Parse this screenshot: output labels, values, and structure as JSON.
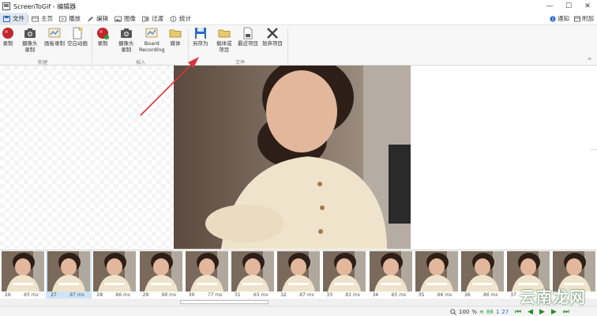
{
  "window": {
    "title": "ScreenToGif - 编辑器",
    "minimize_glyph": "—",
    "maximize_glyph": "☐",
    "close_glyph": "✕"
  },
  "menubar": {
    "tabs": [
      {
        "label": "文件",
        "icon": "save-icon",
        "active": true
      },
      {
        "label": "主页",
        "icon": "home-icon",
        "active": false
      },
      {
        "label": "播放",
        "icon": "play-icon",
        "active": false
      },
      {
        "label": "编辑",
        "icon": "pencil-icon",
        "active": false
      },
      {
        "label": "图像",
        "icon": "image-icon",
        "active": false
      },
      {
        "label": "过渡",
        "icon": "transition-icon",
        "active": false
      },
      {
        "label": "统计",
        "icon": "info-icon",
        "active": false
      }
    ],
    "notify_label": "通知",
    "attach_label": "附加"
  },
  "ribbon": {
    "groups": [
      {
        "label": "新建"
      },
      {
        "label": "插入"
      },
      {
        "label": "文件"
      }
    ],
    "buttons": {
      "record": "录制",
      "webcam": "摄像头\n录制",
      "board": "画板录制",
      "blank": "空白动画",
      "insert_record": "录制",
      "insert_webcam": "摄像头\n录制",
      "board_recording": "Board\nRecording",
      "media": "媒体",
      "save_as": "另存为",
      "load_project": "载体或\n项目",
      "recent_projects": "最近项目",
      "discard_project": "放弃项目"
    },
    "collapse_glyph": "^"
  },
  "thumbnails": [
    {
      "num": "26",
      "dur": "85 ms",
      "selected": false
    },
    {
      "num": "27",
      "dur": "87 ms",
      "selected": true
    },
    {
      "num": "28",
      "dur": "86 ms",
      "selected": false
    },
    {
      "num": "29",
      "dur": "98 ms",
      "selected": false
    },
    {
      "num": "30",
      "dur": "77 ms",
      "selected": false
    },
    {
      "num": "31",
      "dur": "65 ms",
      "selected": false
    },
    {
      "num": "32",
      "dur": "87 ms",
      "selected": false
    },
    {
      "num": "33",
      "dur": "81 ms",
      "selected": false
    },
    {
      "num": "34",
      "dur": "65 ms",
      "selected": false
    },
    {
      "num": "35",
      "dur": "86 ms",
      "selected": false
    },
    {
      "num": "36",
      "dur": "86 ms",
      "selected": false
    },
    {
      "num": "37",
      "dur": "",
      "selected": false
    },
    {
      "num": "",
      "dur": "",
      "selected": false
    }
  ],
  "status": {
    "zoom_value": "100",
    "zoom_unit": "%",
    "frame_count": "86",
    "selected_count": "1",
    "current_frame": "27"
  },
  "colors": {
    "accent": "#2b6cc4",
    "record_red": "#c0262d",
    "arrow_red": "#d9363e"
  },
  "watermark": {
    "text": "云南龙网"
  }
}
